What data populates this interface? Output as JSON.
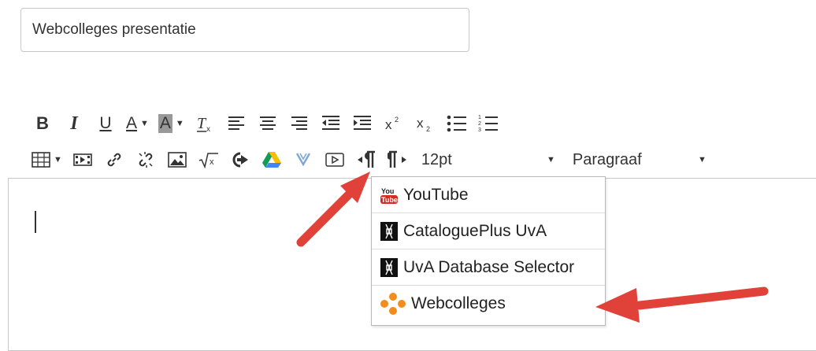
{
  "title_field": {
    "value": "Webcolleges presentatie"
  },
  "toolbar": {
    "bold": "B",
    "italic": "I",
    "underline": "U",
    "text_color": "A",
    "background_color": "A",
    "font_size": "12pt",
    "format": "Paragraaf"
  },
  "media_menu": {
    "items": [
      {
        "label": "YouTube",
        "icon": "youtube-icon"
      },
      {
        "label": "CataloguePlus UvA",
        "icon": "uva-icon"
      },
      {
        "label": "UvA Database Selector",
        "icon": "uva-icon"
      },
      {
        "label": "Webcolleges",
        "icon": "webcolleges-icon"
      }
    ]
  },
  "colors": {
    "annotation_arrow": "#e0423a",
    "webcolleges_orange": "#f28c1b"
  }
}
